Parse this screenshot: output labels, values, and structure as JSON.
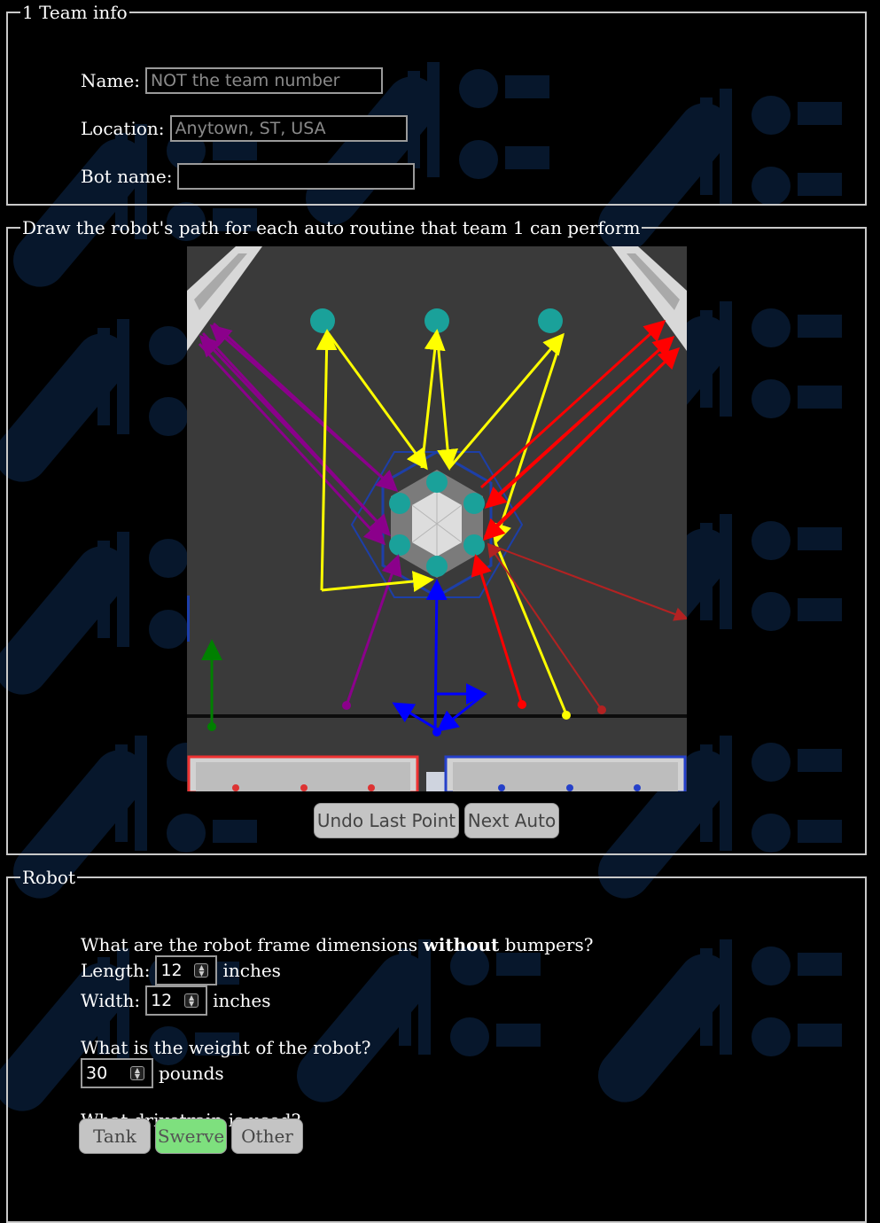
{
  "team_info": {
    "legend": "1 Team info",
    "name_label": "Name:",
    "name_placeholder": "NOT the team number",
    "name_value": "",
    "location_label": "Location:",
    "location_placeholder": "Anytown, ST, USA",
    "location_value": "",
    "bot_label": "Bot name:",
    "bot_value": ""
  },
  "auto": {
    "legend": "Draw the robot's path for each auto routine that team 1 can perform",
    "undo_label": "Undo Last Point",
    "next_label": "Next Auto",
    "path_colors": {
      "purple": "#8b008b",
      "yellow": "#ffff00",
      "red": "#ff0000",
      "blue": "#0000ff",
      "green": "#008000",
      "darkred": "#b22222"
    }
  },
  "robot": {
    "legend": "Robot",
    "dims_q_pre": "What are the robot frame dimensions ",
    "dims_q_bold": "without",
    "dims_q_post": " bumpers?",
    "length_label": "Length:",
    "length_value": "12",
    "length_unit": "inches",
    "width_label": "Width:",
    "width_value": "12",
    "width_unit": "inches",
    "weight_q": "What is the weight of the robot?",
    "weight_value": "30",
    "weight_unit": "pounds",
    "drive_q": "What drivetrain is used?",
    "drive_options": [
      "Tank",
      "Swerve",
      "Other"
    ],
    "drive_selected": "Swerve",
    "selected_color": "#7ee07e"
  }
}
